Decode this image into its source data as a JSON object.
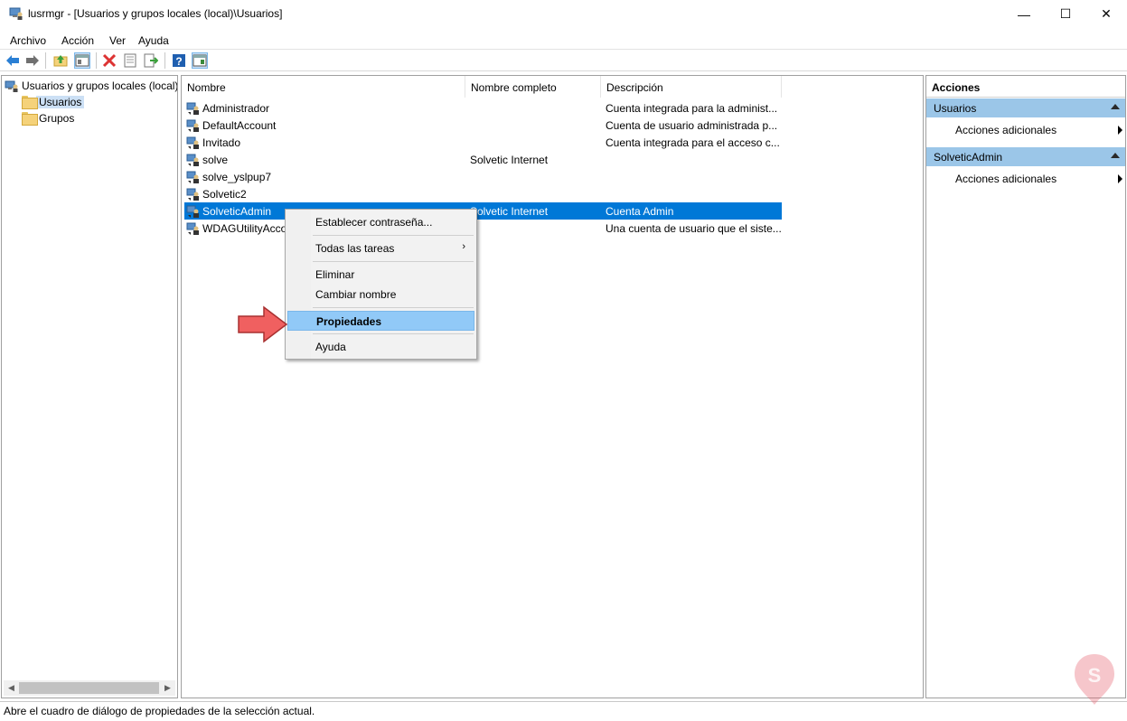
{
  "window": {
    "title": "lusrmgr - [Usuarios y grupos locales (local)\\Usuarios]",
    "minimize": "—",
    "maximize": "☐",
    "close": "✕"
  },
  "menu": [
    "Archivo",
    "Acción",
    "Ver",
    "Ayuda"
  ],
  "toolbar": {
    "icons": [
      "back-icon",
      "forward-icon",
      "up-folder-icon",
      "show-hide-tree-icon",
      "delete-icon",
      "properties-icon",
      "export-icon",
      "help-icon",
      "show-hide-action-pane-icon"
    ]
  },
  "tree": {
    "root": "Usuarios y grupos locales (local)",
    "children": [
      "Usuarios",
      "Grupos"
    ],
    "selected": "Usuarios"
  },
  "list": {
    "columns": [
      "Nombre",
      "Nombre completo",
      "Descripción"
    ],
    "rows": [
      {
        "name": "Administrador",
        "full_name": "",
        "description": "Cuenta integrada para la administ..."
      },
      {
        "name": "DefaultAccount",
        "full_name": "",
        "description": "Cuenta de usuario administrada p..."
      },
      {
        "name": "Invitado",
        "full_name": "",
        "description": "Cuenta integrada para el acceso c..."
      },
      {
        "name": "solve",
        "full_name": "Solvetic Internet",
        "description": ""
      },
      {
        "name": "solve_yslpup7",
        "full_name": "",
        "description": ""
      },
      {
        "name": "Solvetic2",
        "full_name": "",
        "description": ""
      },
      {
        "name": "SolveticAdmin",
        "full_name": "Solvetic Internet",
        "description": "Cuenta Admin"
      },
      {
        "name": "WDAGUtilityAcco",
        "full_name": "",
        "description": "Una cuenta de usuario que el siste..."
      }
    ],
    "selected_row": "SolveticAdmin"
  },
  "context_menu": {
    "items": [
      "Establecer contraseña...",
      "Todas las tareas",
      "Eliminar",
      "Cambiar nombre",
      "Propiedades",
      "Ayuda"
    ],
    "submenu_glyph": "›",
    "highlighted": "Propiedades"
  },
  "actions": {
    "title": "Acciones",
    "sections": [
      {
        "header": "Usuarios",
        "items": [
          "Acciones adicionales"
        ]
      },
      {
        "header": "SolveticAdmin",
        "items": [
          "Acciones adicionales"
        ]
      }
    ]
  },
  "status": {
    "text": "Abre el cuadro de diálogo de propiedades de la selección actual."
  },
  "colors": {
    "selection": "#0078d7",
    "menu_highlight": "#91c9f7",
    "action_header": "#9bc6e8",
    "annotation_arrow": "#f06060"
  }
}
